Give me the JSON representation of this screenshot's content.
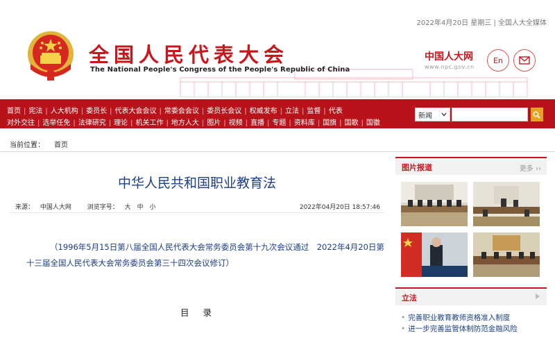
{
  "header": {
    "date_line": "2022年4月20日 星期三 | 全国人大全媒体",
    "title_cn": "全国人民代表大会",
    "title_en": "The National People's Congress of the People's Republic of China",
    "logo_cn": "中国人大网",
    "logo_url": "www.npc.gov.cn",
    "en_button": "En"
  },
  "nav": {
    "row1": [
      "首页",
      "宪法",
      "人大机构",
      "委员长",
      "代表大会会议",
      "常委会会议",
      "委员长会议",
      "权威发布",
      "立法",
      "监督",
      "代表"
    ],
    "row2": [
      "对外交往",
      "选举任免",
      "法律研究",
      "理论",
      "机关工作",
      "地方人大",
      "图片",
      "视频",
      "直播",
      "专题",
      "资料库",
      "国旗",
      "国歌",
      "国徽"
    ],
    "search_scope": "新闻",
    "search_value": ""
  },
  "breadcrumb": {
    "label": "当前位置：",
    "home": "首页"
  },
  "article": {
    "title": "中华人民共和国职业教育法",
    "source_label": "来源：",
    "source": "中国人大网",
    "font_label": "浏览字号：",
    "font_large": "大",
    "font_medium": "中",
    "font_small": "小",
    "datetime": "2022年04月20日 18:57:46",
    "intro": "（1996年5月15日第八届全国人民代表大会常务委员会第十九次会议通过　2022年4月20日第十三届全国人民代表大会常务委员会第三十四次会议修订）",
    "toc_heading": "目录"
  },
  "sidebar": {
    "photo_title": "图片报道",
    "photo_more": "更多",
    "legislation_title": "立法",
    "legislation_items": [
      "完善职业教育教师资格准入制度",
      "进一步完善监管体制防范金融风险"
    ]
  }
}
